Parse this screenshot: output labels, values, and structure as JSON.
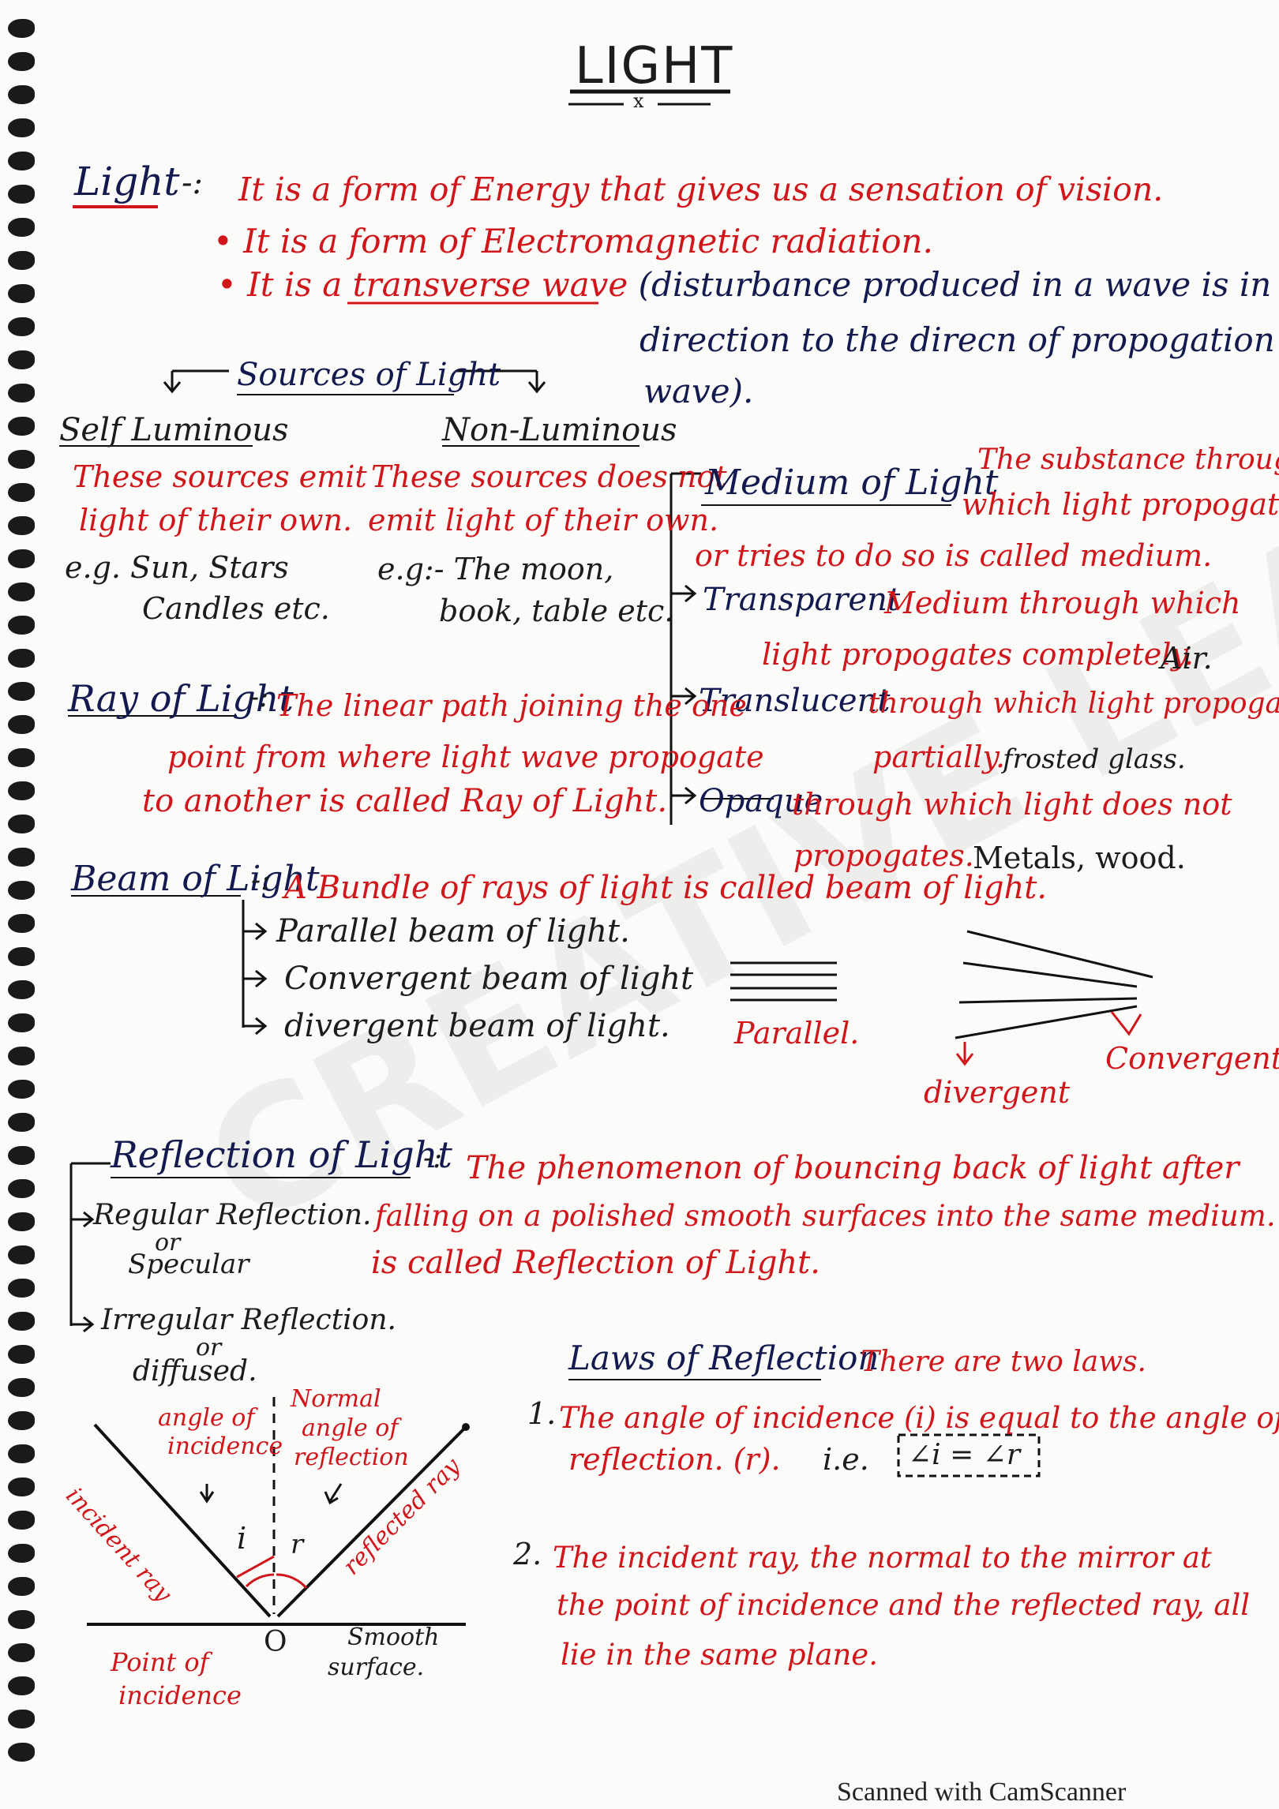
{
  "title": "LIGHT",
  "title_mark": "x",
  "definition": {
    "term": "Light",
    "sep": "-:",
    "line1": "It is a form of Energy that gives us a sensation of vision.",
    "line2": "• It is a form of Electromagnetic radiation.",
    "line3_pre": "• It is a ",
    "line3_underlined": "transverse wave",
    "line3_post": " (disturbance produced in a wave is in ⊥",
    "line4": "direction to the direcn of propogation of",
    "line5": "wave)."
  },
  "sources": {
    "heading": "Sources of Light",
    "self": {
      "heading": "Self Luminous",
      "desc1": "These sources emit",
      "desc2": "light of their own.",
      "eg1": "e.g. Sun, Stars",
      "eg2": "Candles etc."
    },
    "non": {
      "heading": "Non-Luminous",
      "desc1": "These sources does not",
      "desc2": "emit light of their own.",
      "eg1": "e.g:- The moon,",
      "eg2": "book, table etc."
    }
  },
  "medium": {
    "heading": "Medium of Light",
    "def1": "The substance through",
    "def2": "which light propogate",
    "def3": "or tries to do so is called medium.",
    "transparent": {
      "label": "Transparent",
      "desc1": "Medium through which",
      "desc2": "light propogates completely.",
      "eg": "Air."
    },
    "translucent": {
      "label": "Translucent",
      "desc1": "through which light propogates",
      "desc2": "partially.",
      "eg": "frosted glass."
    },
    "opaque": {
      "label": "Opaque",
      "desc1": "through which light does not",
      "desc2": "propogates.",
      "eg": "Metals, wood."
    }
  },
  "ray": {
    "term": "Ray of Light",
    "sep": "-:",
    "def1": "The linear path joining the one",
    "def2": "point from where light wave propogate",
    "def3": "to another is called Ray of Light."
  },
  "beam": {
    "term": "Beam of Light",
    "sep": "-:",
    "def": "A Bundle of rays of light is called beam of light.",
    "types": [
      "Parallel beam of light.",
      "Convergent beam of light",
      "divergent beam of light."
    ],
    "label_parallel": "Parallel.",
    "label_divergent": "divergent",
    "label_convergent": "Convergent"
  },
  "reflection": {
    "term": "Reflection of Light",
    "sep": "-:",
    "def1": "The phenomenon of bouncing back of light after",
    "def2": "falling on a polished smooth surfaces into the same medium.",
    "def3": "is called Reflection of Light.",
    "regular1": "Regular Reflection.",
    "regular2": "or",
    "regular3": "Specular",
    "irregular1": "Irregular Reflection.",
    "irregular2": "or",
    "irregular3": "diffused."
  },
  "diagram": {
    "angle_incidence": [
      "angle of",
      "incidence"
    ],
    "normal": "Normal",
    "angle_reflection": [
      "angle of",
      "reflection"
    ],
    "incident_ray": "incident ray",
    "reflected_ray": "reflected ray",
    "i": "i",
    "r": "r",
    "o": "O",
    "point": [
      "Point of",
      "incidence"
    ],
    "smooth": [
      "Smooth",
      "surface."
    ]
  },
  "laws": {
    "heading": "Laws of Reflection",
    "note": "There are two laws.",
    "law1_num": "1.",
    "law1_a": "The angle of incidence (i) is equal to the angle of",
    "law1_b": "reflection. (r).",
    "law1_ie": "i.e.",
    "law1_formula": "∠i = ∠r",
    "law2_num": "2.",
    "law2_a": "The incident ray, the normal to the mirror at",
    "law2_b": "the point of incidence and the reflected ray, all",
    "law2_c": "lie in the same plane."
  },
  "watermark": "CREATIVE LEARNING",
  "footer": "Scanned with CamScanner"
}
